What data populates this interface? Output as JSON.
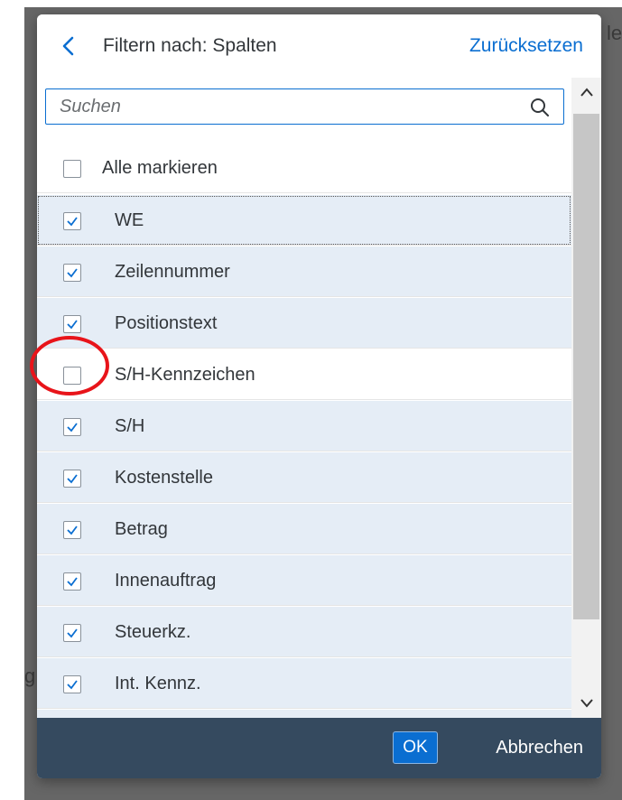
{
  "background_fragments": {
    "top_right": "le",
    "left_middle": "g"
  },
  "popover": {
    "title": "Filtern nach: Spalten",
    "reset_label": "Zurücksetzen",
    "back_icon": "chevron-left-icon"
  },
  "search": {
    "placeholder": "Suchen",
    "value": "",
    "icon": "search-icon"
  },
  "list": {
    "select_all": {
      "label": "Alle markieren",
      "checked": false
    },
    "items": [
      {
        "label": "WE",
        "checked": true,
        "focused": true
      },
      {
        "label": "Zeilennummer",
        "checked": true
      },
      {
        "label": "Positionstext",
        "checked": true
      },
      {
        "label": "S/H-Kennzeichen",
        "checked": false
      },
      {
        "label": "S/H",
        "checked": true
      },
      {
        "label": "Kostenstelle",
        "checked": true
      },
      {
        "label": "Betrag",
        "checked": true
      },
      {
        "label": "Innenauftrag",
        "checked": true
      },
      {
        "label": "Steuerkz.",
        "checked": true
      },
      {
        "label": "Int. Kennz.",
        "checked": true
      }
    ]
  },
  "footer": {
    "ok_label": "OK",
    "cancel_label": "Abbrechen"
  },
  "colors": {
    "accent": "#0a6ed1",
    "footer_bg": "#354a5f",
    "selected_row_bg": "#e5edf6",
    "annotation": "#e8141a"
  }
}
